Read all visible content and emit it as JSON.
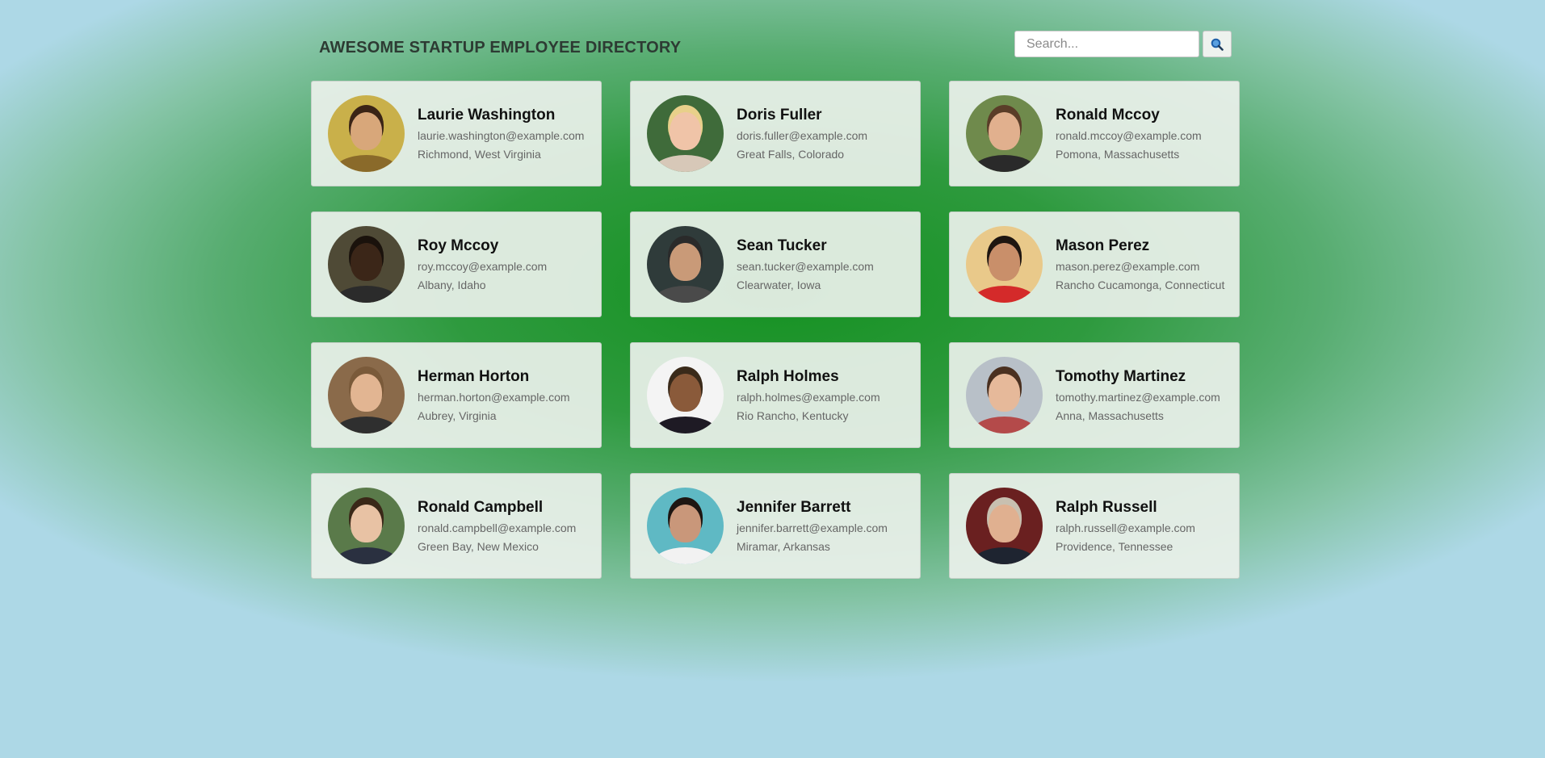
{
  "header": {
    "title": "AWESOME STARTUP EMPLOYEE DIRECTORY",
    "search": {
      "placeholder": "Search...",
      "value": "",
      "button_icon": "search-icon"
    }
  },
  "employees": [
    {
      "name": "Laurie Washington",
      "email": "laurie.washington@example.com",
      "location": "Richmond, West Virginia",
      "avatar_colors": {
        "bg": "#c9b04a",
        "skin": "#d8a77a",
        "hair": "#3a2416",
        "shirt": "#8a6a2a"
      }
    },
    {
      "name": "Doris Fuller",
      "email": "doris.fuller@example.com",
      "location": "Great Falls, Colorado",
      "avatar_colors": {
        "bg": "#3f6b3a",
        "skin": "#f0c4a8",
        "hair": "#e8d08a",
        "shirt": "#d7c8b8"
      }
    },
    {
      "name": "Ronald Mccoy",
      "email": "ronald.mccoy@example.com",
      "location": "Pomona, Massachusetts",
      "avatar_colors": {
        "bg": "#6f8a4c",
        "skin": "#e1b08e",
        "hair": "#5a3d28",
        "shirt": "#2a2a2a"
      }
    },
    {
      "name": "Roy Mccoy",
      "email": "roy.mccoy@example.com",
      "location": "Albany, Idaho",
      "avatar_colors": {
        "bg": "#4f4a36",
        "skin": "#3b2618",
        "hair": "#1a120c",
        "shirt": "#2b2b2b"
      }
    },
    {
      "name": "Sean Tucker",
      "email": "sean.tucker@example.com",
      "location": "Clearwater, Iowa",
      "avatar_colors": {
        "bg": "#2f3b3a",
        "skin": "#c99a78",
        "hair": "#2a2a2a",
        "shirt": "#4a4a4a"
      }
    },
    {
      "name": "Mason Perez",
      "email": "mason.perez@example.com",
      "location": "Rancho Cucamonga, Connecticut",
      "avatar_colors": {
        "bg": "#e9c98a",
        "skin": "#c98f6a",
        "hair": "#1e1510",
        "shirt": "#d42a2a"
      }
    },
    {
      "name": "Herman Horton",
      "email": "herman.horton@example.com",
      "location": "Aubrey, Virginia",
      "avatar_colors": {
        "bg": "#8a6a4a",
        "skin": "#e2b592",
        "hair": "#7a5a3a",
        "shirt": "#2f2f2f"
      }
    },
    {
      "name": "Ralph Holmes",
      "email": "ralph.holmes@example.com",
      "location": "Rio Rancho, Kentucky",
      "avatar_colors": {
        "bg": "#f4f4f4",
        "skin": "#8a5a3a",
        "hair": "#3a2a1a",
        "shirt": "#1e1a24"
      }
    },
    {
      "name": "Tomothy Martinez",
      "email": "tomothy.martinez@example.com",
      "location": "Anna, Massachusetts",
      "avatar_colors": {
        "bg": "#b8c0c8",
        "skin": "#e6b99a",
        "hair": "#4a3020",
        "shirt": "#b44a4a"
      }
    },
    {
      "name": "Ronald Campbell",
      "email": "ronald.campbell@example.com",
      "location": "Green Bay, New Mexico",
      "avatar_colors": {
        "bg": "#5a7a4a",
        "skin": "#e8c2a4",
        "hair": "#3a2818",
        "shirt": "#2a3040"
      }
    },
    {
      "name": "Jennifer Barrett",
      "email": "jennifer.barrett@example.com",
      "location": "Miramar, Arkansas",
      "avatar_colors": {
        "bg": "#5fb9c4",
        "skin": "#c9977a",
        "hair": "#1e1612",
        "shirt": "#f2f2f2"
      }
    },
    {
      "name": "Ralph Russell",
      "email": "ralph.russell@example.com",
      "location": "Providence, Tennessee",
      "avatar_colors": {
        "bg": "#6a2020",
        "skin": "#e0b090",
        "hair": "#c8c0b0",
        "shirt": "#1e2430"
      }
    }
  ]
}
